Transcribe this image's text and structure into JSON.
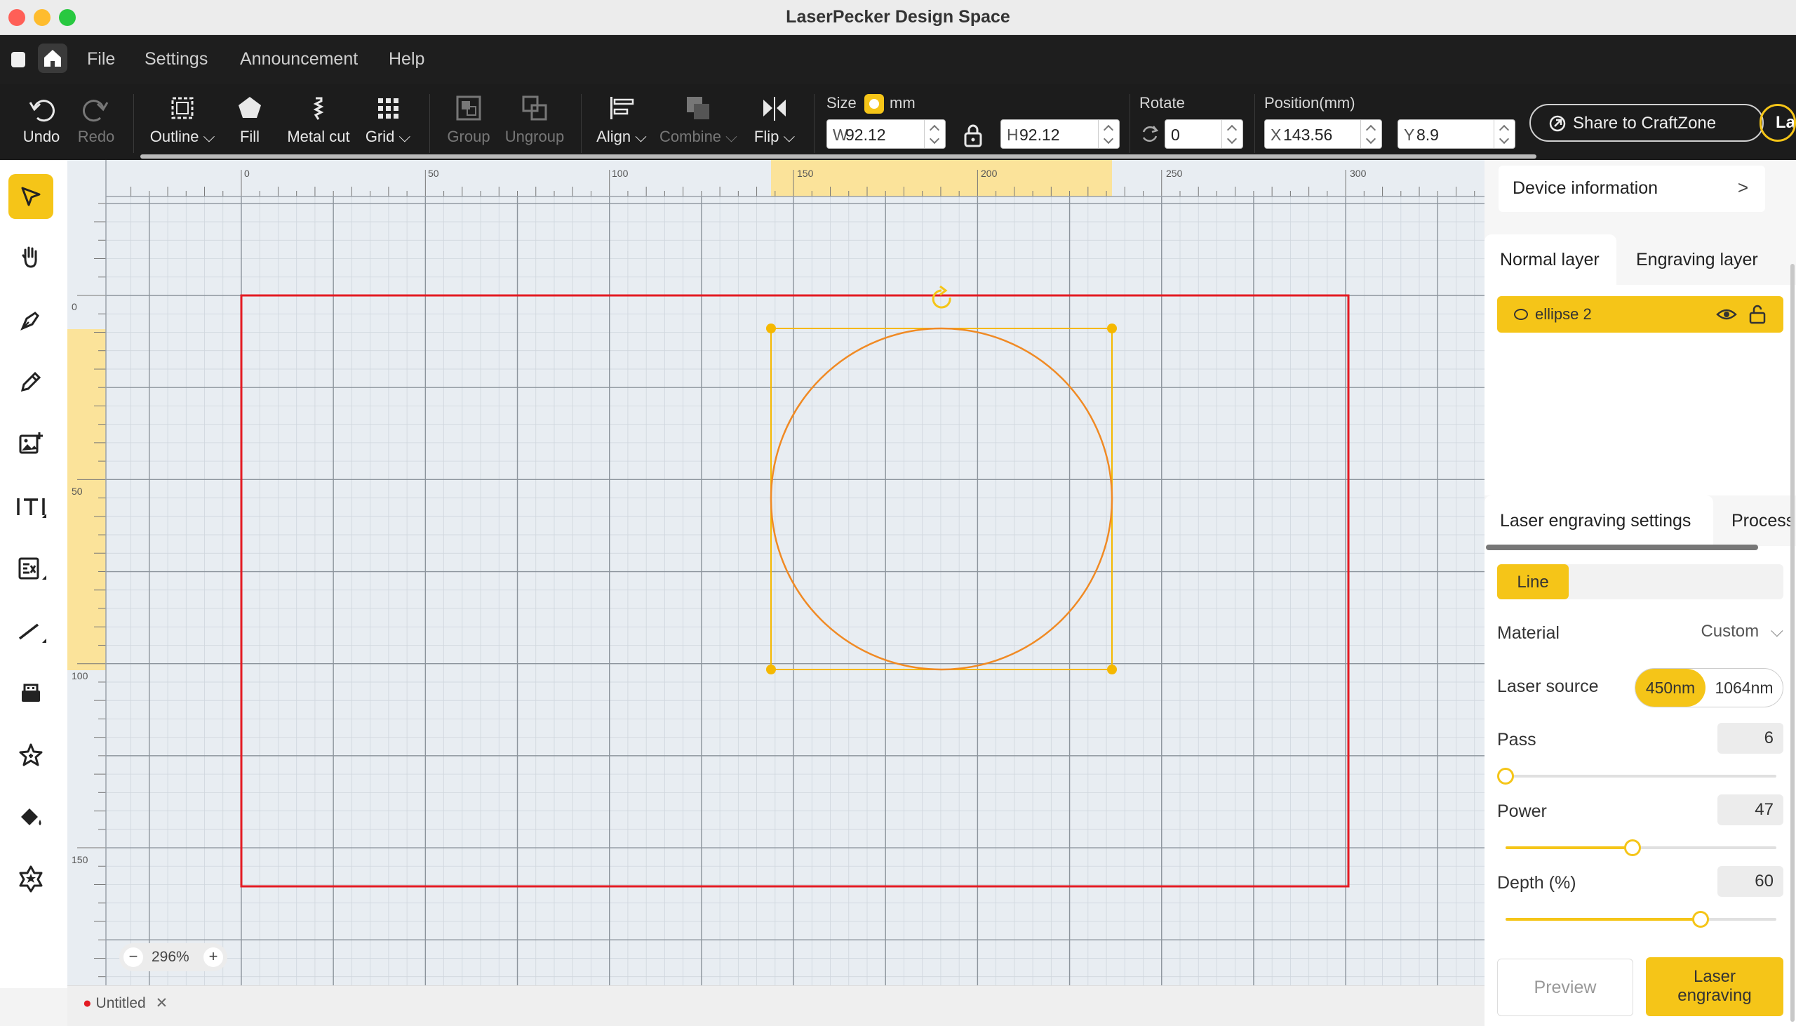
{
  "window": {
    "title": "LaserPecker Design Space"
  },
  "menu": [
    "File",
    "Settings",
    "Announcement",
    "Help"
  ],
  "toolbar": {
    "undo": "Undo",
    "redo": "Redo",
    "outline": "Outline",
    "fill": "Fill",
    "metal_cut": "Metal cut",
    "grid": "Grid",
    "group": "Group",
    "ungroup": "Ungroup",
    "align": "Align",
    "combine": "Combine",
    "flip": "Flip",
    "size_label": "Size",
    "unit": "mm",
    "width_prefix": "W",
    "width": "92.12",
    "height_prefix": "H",
    "height": "92.12",
    "rotate_label": "Rotate",
    "rotate": "0",
    "position_label": "Position(mm)",
    "x_prefix": "X",
    "x": "143.56",
    "y_prefix": "Y",
    "y": "8.9",
    "share": "Share to CraftZone",
    "laser_partial": "La"
  },
  "canvas": {
    "ruler_x_labels": [
      "0",
      "50",
      "100",
      "150",
      "200",
      "250",
      "300"
    ],
    "ruler_y_labels": [
      "0",
      "50",
      "100",
      "150"
    ],
    "zoom": "296%",
    "colors": {
      "work_area": "#e31b23",
      "shape": "#f08a24",
      "selection": "#f5b800"
    }
  },
  "document_tab": {
    "name": "Untitled"
  },
  "panel": {
    "device_info": "Device information",
    "layer_tabs": [
      "Normal layer",
      "Engraving layer"
    ],
    "layers": [
      {
        "name": "ellipse 2"
      }
    ],
    "settings_tabs": [
      "Laser engraving settings",
      "Process"
    ],
    "mode": "Line",
    "material_label": "Material",
    "material_value": "Custom",
    "laser_source_label": "Laser source",
    "laser_sources": [
      "450nm",
      "1064nm"
    ],
    "pass_label": "Pass",
    "pass": "6",
    "power_label": "Power",
    "power": "47",
    "depth_label": "Depth (%)",
    "depth": "60",
    "preview": "Preview",
    "engrave_line1": "Laser",
    "engrave_line2": "engraving"
  }
}
